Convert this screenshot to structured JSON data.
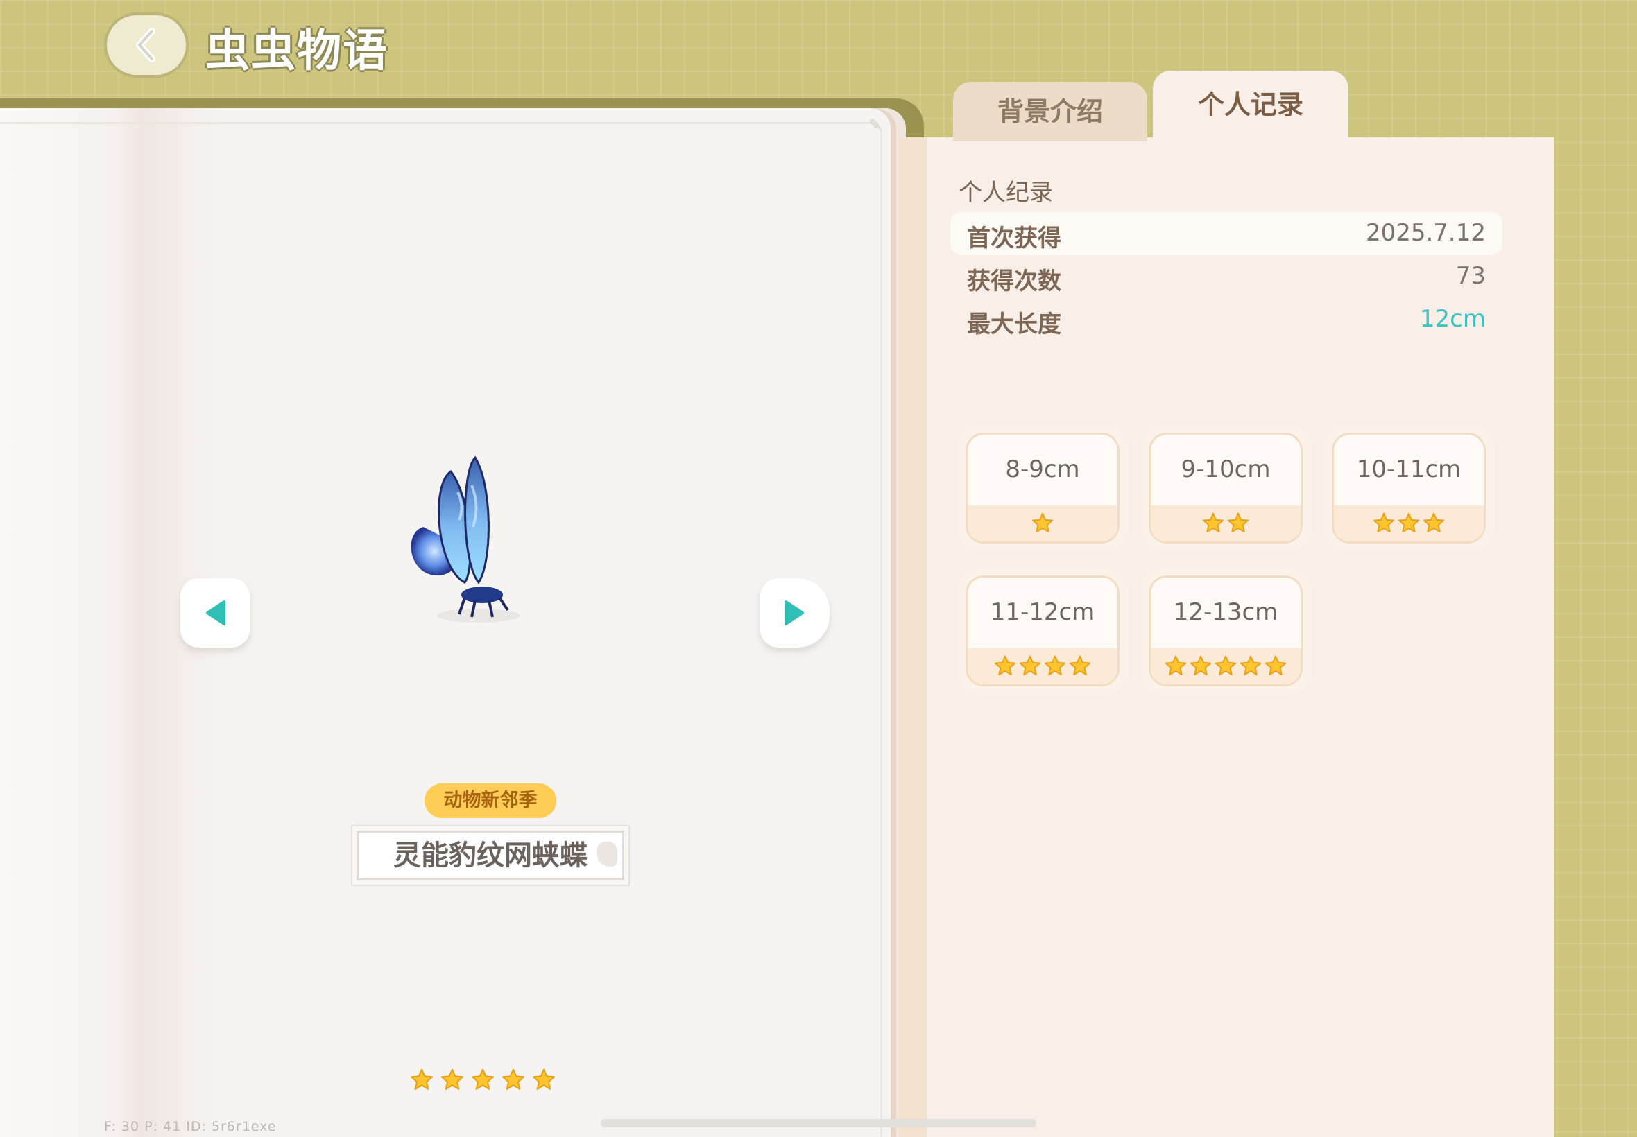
{
  "header": {
    "title": "虫虫物语"
  },
  "insect": {
    "season_tag": "动物新邻季",
    "name": "灵能豹纹网蛱蝶",
    "rarity_stars": 5
  },
  "tabs": [
    {
      "label": "背景介绍",
      "active": false
    },
    {
      "label": "个人记录",
      "active": true
    }
  ],
  "record": {
    "title": "个人纪录",
    "rows": [
      {
        "key": "首次获得",
        "value": "2025.7.12"
      },
      {
        "key": "获得次数",
        "value": "73"
      },
      {
        "key": "最大长度",
        "value": "12cm"
      }
    ]
  },
  "size_tiers": [
    {
      "label": "8-9cm",
      "stars": 1
    },
    {
      "label": "9-10cm",
      "stars": 2
    },
    {
      "label": "10-11cm",
      "stars": 3
    },
    {
      "label": "11-12cm",
      "stars": 4
    },
    {
      "label": "12-13cm",
      "stars": 5
    }
  ],
  "debug": {
    "text": "F: 30    P: 41    ID: 5r6r1exe"
  },
  "colors": {
    "accent_teal": "#3fc2c2",
    "star_gold": "#ffc42e",
    "tag_yellow": "#ffcc55"
  },
  "icons": {
    "back": "chevron-left-icon",
    "prev": "triangle-left-icon",
    "next": "triangle-right-icon",
    "star": "star-icon"
  }
}
